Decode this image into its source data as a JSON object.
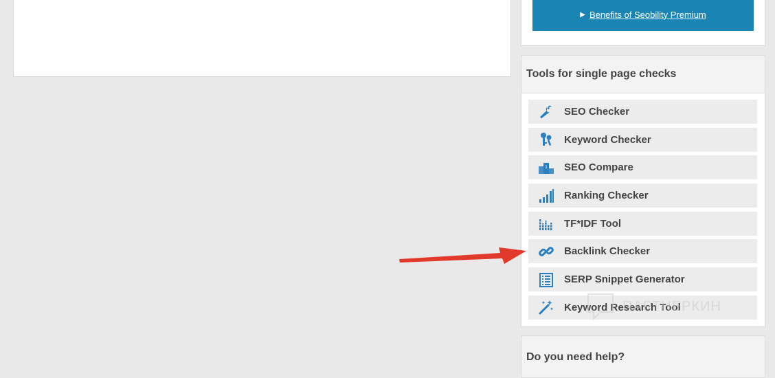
{
  "premium": {
    "link_text": "Benefits of Seobility Premium",
    "accent": "#1a84b5"
  },
  "tools_panel": {
    "title": "Tools for single page checks",
    "items": [
      {
        "label": "SEO Checker",
        "icon": "wrench-icon"
      },
      {
        "label": "Keyword Checker",
        "icon": "keys-icon"
      },
      {
        "label": "SEO Compare",
        "icon": "podium-icon"
      },
      {
        "label": "Ranking Checker",
        "icon": "signal-bars-icon"
      },
      {
        "label": "TF*IDF Tool",
        "icon": "bar-graph-icon"
      },
      {
        "label": "Backlink Checker",
        "icon": "link-icon"
      },
      {
        "label": "SERP Snippet Generator",
        "icon": "list-icon"
      },
      {
        "label": "Keyword Research Tool",
        "icon": "magic-wand-icon"
      }
    ]
  },
  "help_panel": {
    "title": "Do you need help?"
  },
  "watermark": {
    "text": "ПАРТНЕРКИН"
  },
  "colors": {
    "icon_blue": "#2a7fc1",
    "arrow_red": "#e23a2a"
  }
}
